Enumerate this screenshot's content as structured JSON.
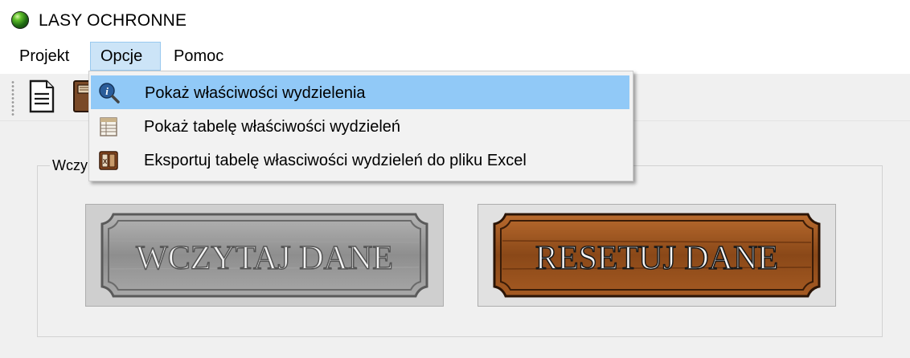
{
  "window": {
    "title": "LASY OCHRONNE",
    "icon": "green-orb-icon"
  },
  "menubar": {
    "items": [
      {
        "label": "Projekt"
      },
      {
        "label": "Opcje"
      },
      {
        "label": "Pomoc"
      }
    ],
    "open_menu": "Opcje"
  },
  "toolbar": {
    "buttons": [
      {
        "icon": "new-document-icon"
      },
      {
        "icon": "open-file-icon"
      }
    ]
  },
  "group": {
    "label": "Wczy"
  },
  "buttons": {
    "load_label": "WCZYTAJ DANE",
    "reset_label": "RESETUJ DANE"
  },
  "dropdown": {
    "items": [
      {
        "label": "Pokaż właściwości wydzielenia",
        "icon": "info-magnifier-icon",
        "highlighted": true
      },
      {
        "label": "Pokaż tabelę właściwości wydzieleń",
        "icon": "table-icon",
        "highlighted": false
      },
      {
        "label": "Eksportuj tabelę własciwości wydzieleń do pliku Excel",
        "icon": "excel-export-icon",
        "highlighted": false
      }
    ]
  },
  "colors": {
    "menu_highlight": "#91c9f7",
    "menu_hover": "#cce4f7",
    "wood_brown": "#8a4a1c",
    "wood_gray": "#9a9a9a"
  }
}
